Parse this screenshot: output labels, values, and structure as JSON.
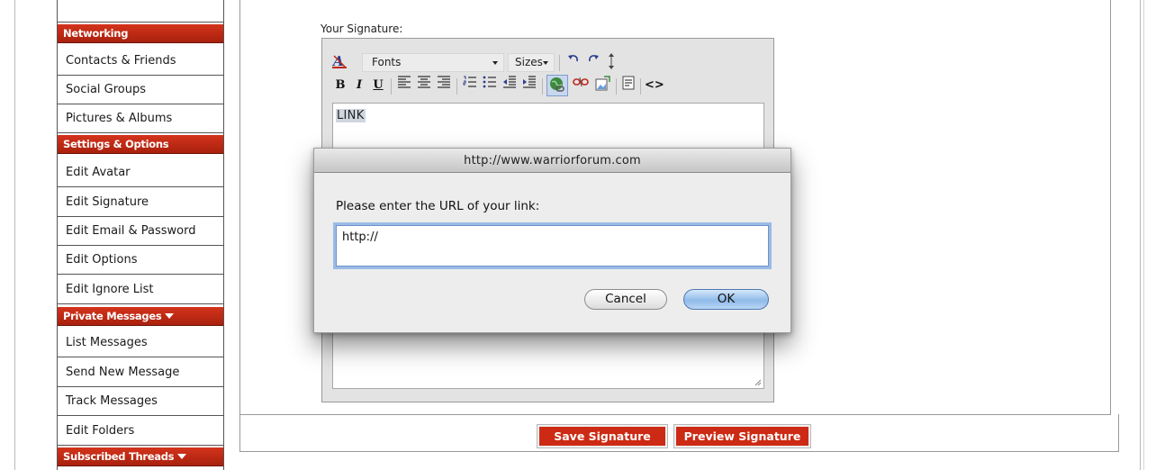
{
  "sidebar": {
    "sections": [
      {
        "header": "Networking",
        "items": [
          "Contacts & Friends",
          "Social Groups",
          "Pictures & Albums"
        ]
      },
      {
        "header": "Settings & Options",
        "items": [
          "Edit Avatar",
          "Edit Signature",
          "Edit Email & Password",
          "Edit Options",
          "Edit Ignore List"
        ]
      },
      {
        "header": "Private Messages",
        "items": [
          "List Messages",
          "Send New Message",
          "Track Messages",
          "Edit Folders"
        ]
      },
      {
        "header": "Subscribed Threads",
        "items": []
      }
    ]
  },
  "editor": {
    "label": "Your Signature:",
    "font_select": "Fonts",
    "size_select": "Sizes",
    "content": "LINK",
    "toolbar_icons": [
      "bold-icon",
      "italic-icon",
      "underline-icon",
      "align-left-icon",
      "align-center-icon",
      "align-right-icon",
      "ordered-list-icon",
      "unordered-list-icon",
      "outdent-icon",
      "indent-icon",
      "insert-link-icon",
      "remove-link-icon",
      "insert-image-icon",
      "insert-quote-icon",
      "source-mode-icon",
      "undo-icon",
      "redo-icon",
      "resize-icon",
      "remove-format-icon"
    ]
  },
  "buttons": {
    "save": "Save Signature",
    "preview": "Preview Signature"
  },
  "dialog": {
    "title": "http://www.warriorforum.com",
    "prompt": "Please enter the URL of your link:",
    "input_value": "http://",
    "cancel": "Cancel",
    "ok": "OK"
  },
  "colors": {
    "sidebar_header": "#c02a14",
    "button_red": "#cc2a14",
    "ok_button": "#8fbbe9"
  }
}
